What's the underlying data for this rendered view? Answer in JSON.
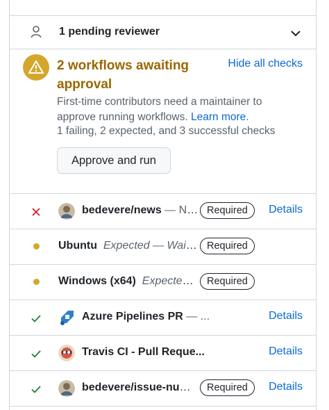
{
  "pending": {
    "label": "1 pending reviewer"
  },
  "approval": {
    "title": "2 workflows awaiting approval",
    "hide_link": "Hide all checks",
    "desc_text": "First-time contributors need a maintainer to approve running workflows. ",
    "learn_more": "Learn more",
    "desc_end": ".",
    "summary": "1 failing, 2 expected, and 3 successful checks",
    "button": "Approve and run"
  },
  "checks": [
    {
      "status": "fail",
      "name": "bedevere/news",
      "rest": " — No ...",
      "badge": "Required",
      "details": "Details"
    },
    {
      "status": "expected",
      "name": "Ubuntu",
      "rest": "Expected — Waitin...",
      "badge": "Required"
    },
    {
      "status": "expected",
      "name": "Windows (x64)",
      "rest": "Expected ...",
      "badge": "Required"
    },
    {
      "status": "success",
      "name": "Azure Pipelines PR",
      "rest": " — ...",
      "details": "Details"
    },
    {
      "status": "success",
      "name": "Travis CI - Pull Reque...",
      "details": "Details"
    },
    {
      "status": "success",
      "name": "bedevere/issue-numb...",
      "badge": "Required",
      "details": "Details"
    }
  ],
  "colors": {
    "warning": "#d4a72c",
    "warning_text": "#9a6700",
    "link": "#0969da",
    "fail": "#cf222e",
    "success": "#1a7f37"
  }
}
